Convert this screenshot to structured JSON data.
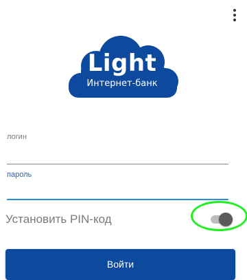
{
  "header": {
    "menu_icon": "more-vert-icon"
  },
  "logo": {
    "title": "Light",
    "subtitle": "Интернет-банк",
    "color": "#0d4a9e"
  },
  "form": {
    "login": {
      "label": "логин",
      "value": ""
    },
    "password": {
      "label": "пароль",
      "value": "",
      "focus_color": "#2a8fd6"
    },
    "pin": {
      "label": "Установить PIN-код",
      "enabled": true,
      "highlight_color": "#22ee22"
    },
    "submit_label": "Войти"
  },
  "colors": {
    "primary": "#0d4a9e",
    "accent": "#2a8fd6"
  }
}
